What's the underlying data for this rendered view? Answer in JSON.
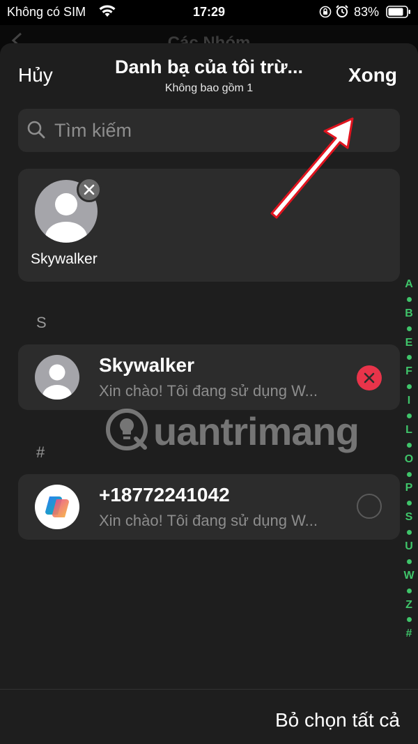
{
  "status_bar": {
    "carrier": "Không có SIM",
    "time": "17:29",
    "battery_pct": "83%",
    "icons": [
      "wifi-icon",
      "orientation-lock-icon",
      "alarm-icon",
      "battery-icon"
    ]
  },
  "background_screen": {
    "title": "Các Nhóm"
  },
  "header": {
    "cancel_label": "Hủy",
    "title": "Danh bạ của tôi trừ...",
    "subtitle": "Không bao gồm 1",
    "done_label": "Xong"
  },
  "search": {
    "placeholder": "Tìm kiếm"
  },
  "selected": [
    {
      "name": "Skywalker"
    }
  ],
  "sections": [
    {
      "letter": "S",
      "contacts": [
        {
          "name": "Skywalker",
          "status": "Xin chào! Tôi đang sử dụng W...",
          "selected": true
        }
      ]
    },
    {
      "letter": "#",
      "contacts": [
        {
          "name": "+18772241042",
          "status": "Xin chào! Tôi đang sử dụng W...",
          "selected": false
        }
      ]
    }
  ],
  "index": [
    "A",
    "B",
    "E",
    "F",
    "I",
    "L",
    "O",
    "P",
    "S",
    "U",
    "W",
    "Z",
    "#"
  ],
  "watermark": "uantrimang",
  "footer": {
    "deselect_all_label": "Bỏ chọn tất cả"
  },
  "colors": {
    "accent_index": "#3fc56a",
    "remove_red": "#e8344a",
    "sheet_bg": "#1e1e1e",
    "card_bg": "#2c2c2c"
  }
}
